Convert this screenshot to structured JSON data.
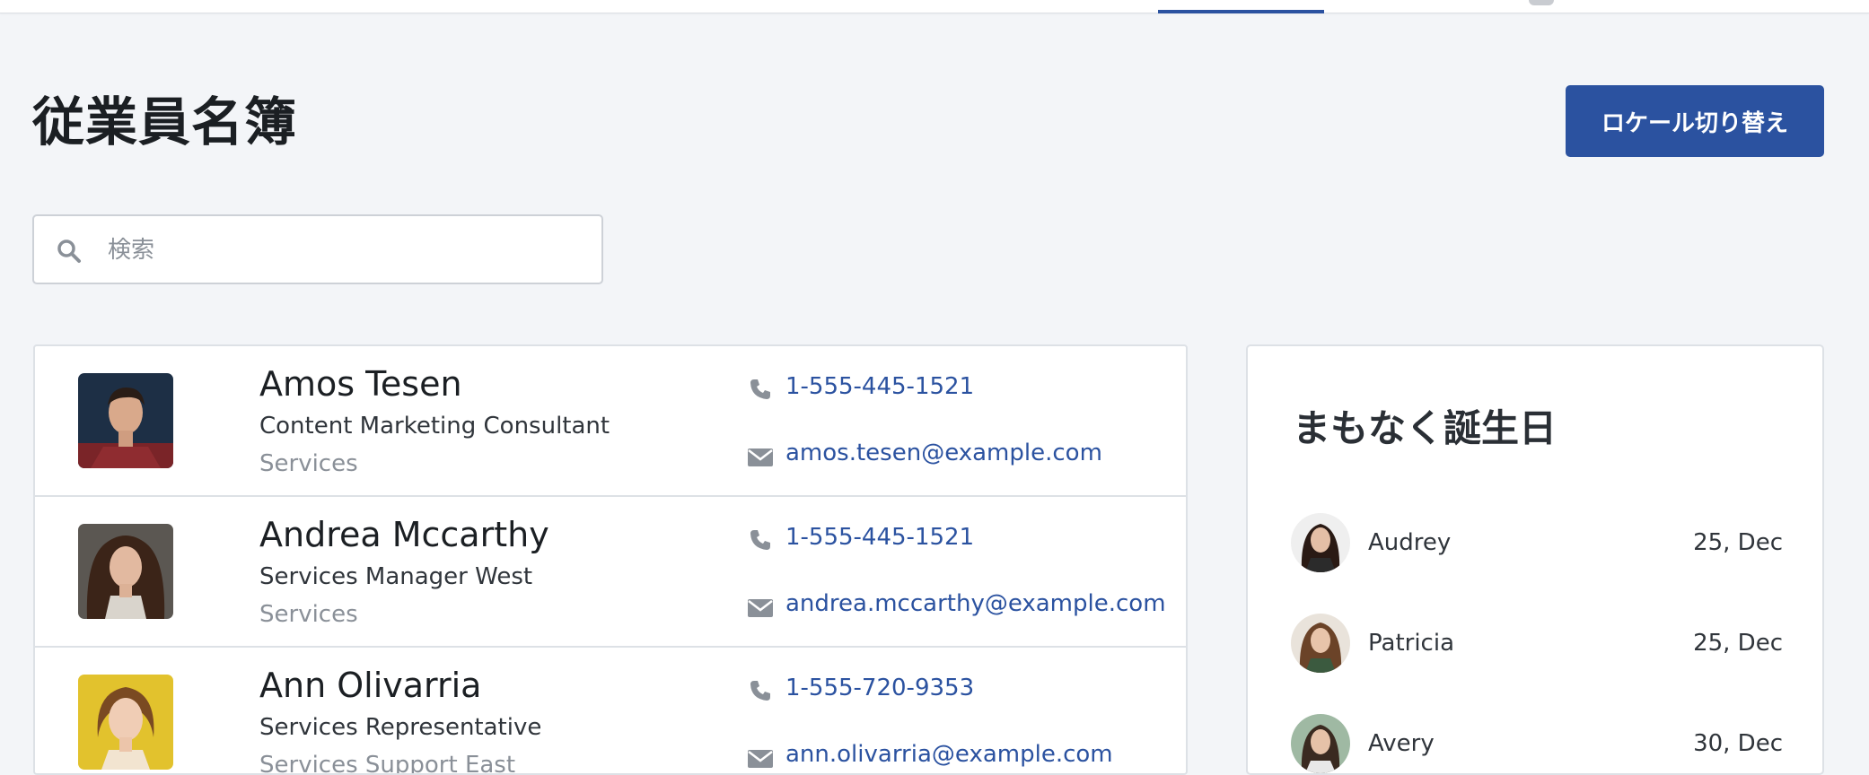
{
  "header": {
    "title": "従業員名簿",
    "locale_button_label": "ロケール切り替え"
  },
  "search": {
    "value": "",
    "placeholder": "検索"
  },
  "employees": [
    {
      "name": "Amos Tesen",
      "title": "Content Marketing Consultant",
      "department": "Services",
      "phone": "1-555-445-1521",
      "email": "amos.tesen@example.com"
    },
    {
      "name": "Andrea Mccarthy",
      "title": "Services Manager West",
      "department": "Services",
      "phone": "1-555-445-1521",
      "email": "andrea.mccarthy@example.com"
    },
    {
      "name": "Ann Olivarria",
      "title": "Services Representative",
      "department": "Services Support East",
      "phone": "1-555-720-9353",
      "email": "ann.olivarria@example.com"
    }
  ],
  "birthdays": {
    "title": "まもなく誕生日",
    "items": [
      {
        "name": "Audrey",
        "date": "25, Dec"
      },
      {
        "name": "Patricia",
        "date": "25, Dec"
      },
      {
        "name": "Avery",
        "date": "30, Dec"
      }
    ]
  },
  "colors": {
    "accent": "#2b52a0",
    "background": "#f3f5f8",
    "link": "#2b52a0",
    "muted_text": "#8a9098"
  }
}
